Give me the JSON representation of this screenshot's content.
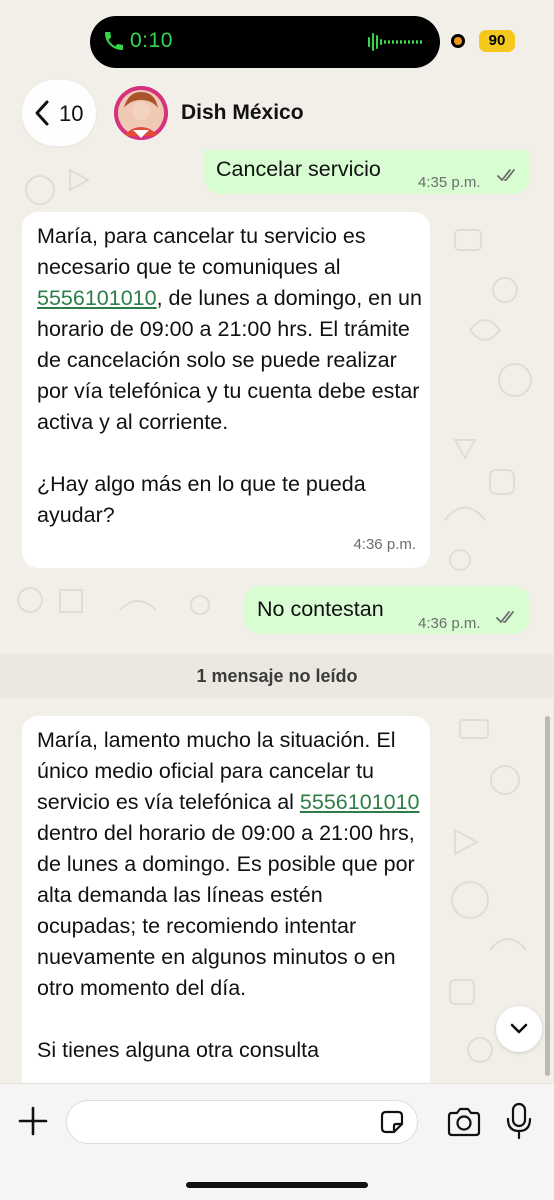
{
  "status_bar": {
    "call_timer": "0:10",
    "battery_level": "90",
    "call_color": "#35d64b",
    "battery_color": "#f4c91d"
  },
  "header": {
    "back_count": "10",
    "contact_name": "Dish México"
  },
  "messages": [
    {
      "direction": "outgoing",
      "text": "Cancelar servicio",
      "time": "4:35 p.m.",
      "status": "read"
    },
    {
      "direction": "incoming",
      "text_before_link": "María, para cancelar tu servicio es necesario que te comuniques al",
      "link": "5556101010",
      "text_after_link": ", de lunes a domingo, en un horario de 09:00 a 21:00 hrs. El trámite de cancelación solo se puede realizar por vía telefónica y tu cuenta debe estar activa y al corriente.\n\n¿Hay algo más en lo que te pueda ayudar?",
      "time": "4:36 p.m."
    },
    {
      "direction": "outgoing",
      "text": "No contestan",
      "time": "4:36 p.m.",
      "status": "read"
    },
    {
      "direction": "incoming",
      "text_before_link": "María, lamento mucho la situación. El único medio oficial para cancelar tu servicio es vía telefónica al",
      "link": "5556101010",
      "text_after_link": " dentro del horario de 09:00 a 21:00 hrs, de lunes a domingo. Es posible que por alta demanda las líneas estén ocupadas; te recomiendo intentar nuevamente en algunos minutos o en otro momento del día.\n\nSi tienes alguna otra consulta"
    }
  ],
  "unread_divider": "1 mensaje no leído",
  "input_bar": {
    "placeholder": "",
    "icons": [
      "plus-icon",
      "sticker-icon",
      "camera-icon",
      "microphone-icon"
    ]
  },
  "colors": {
    "outgoing_bubble": "#d9fdd3",
    "incoming_bubble": "#ffffff",
    "link": "#2e7d46",
    "wallpaper": "#f2efe9"
  }
}
